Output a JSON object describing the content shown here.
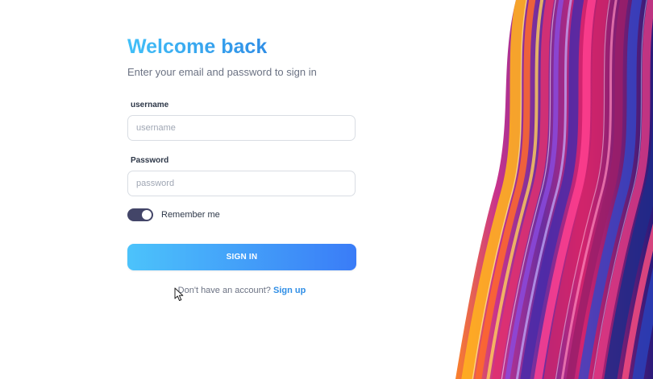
{
  "form": {
    "title": "Welcome back",
    "subtitle": "Enter your email and password to sign in",
    "username_label": "username",
    "username_placeholder": "username",
    "username_value": "",
    "password_label": "Password",
    "password_placeholder": "password",
    "password_value": "",
    "remember_label": "Remember me",
    "remember_on": true,
    "signin_label": "SIGN IN",
    "signup_prompt": "Don't have an account?",
    "signup_link": "Sign up"
  },
  "colors": {
    "title_gradient_start": "#42c0f8",
    "title_gradient_end": "#2f8ee6",
    "button_gradient_start": "#4cc3fb",
    "button_gradient_end": "#3a7cf7",
    "toggle_on": "#434568",
    "link": "#2f8ee6"
  },
  "icons": {
    "cursor": "mouse-pointer-icon"
  }
}
